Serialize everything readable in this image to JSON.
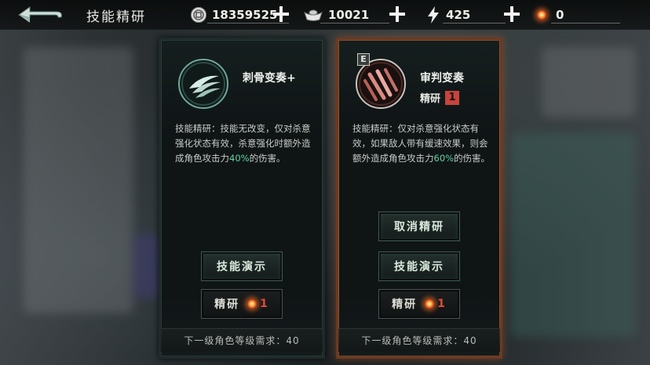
{
  "header": {
    "title": "技能精研",
    "resources": [
      {
        "icon": "coin-icon",
        "value": "18359525"
      },
      {
        "icon": "ingot-icon",
        "value": "10021"
      },
      {
        "icon": "lightning-icon",
        "value": "425"
      },
      {
        "icon": "ember-orb-icon",
        "value": "0"
      }
    ]
  },
  "cards": [
    {
      "name": "刺骨变奏+",
      "description_parts": [
        "技能精研：技能无改变，仅对杀意强化状态有效，杀意强化时额外造成角色攻击力",
        "40%",
        "的伤害。"
      ],
      "demo_button": "技能演示",
      "refine_button": {
        "label": "精研",
        "cost": "1"
      },
      "requirement": "下一级角色等级需求：40"
    },
    {
      "name": "审判变奏",
      "badge": "E",
      "rank_label": "精研",
      "rank_value": "1",
      "description_parts": [
        "技能精研：仅对杀意强化状态有效，如果敌人带有缓速效果，则会额外造成角色攻击力",
        "60%",
        "的伤害。"
      ],
      "cancel_button": "取消精研",
      "demo_button": "技能演示",
      "refine_button": {
        "label": "精研",
        "cost": "1"
      },
      "requirement": "下一级角色等级需求：40"
    }
  ],
  "colors": {
    "highlight": "#5fd3a4",
    "selected_border": "#a0522d",
    "cost_red": "#e04a3c"
  }
}
